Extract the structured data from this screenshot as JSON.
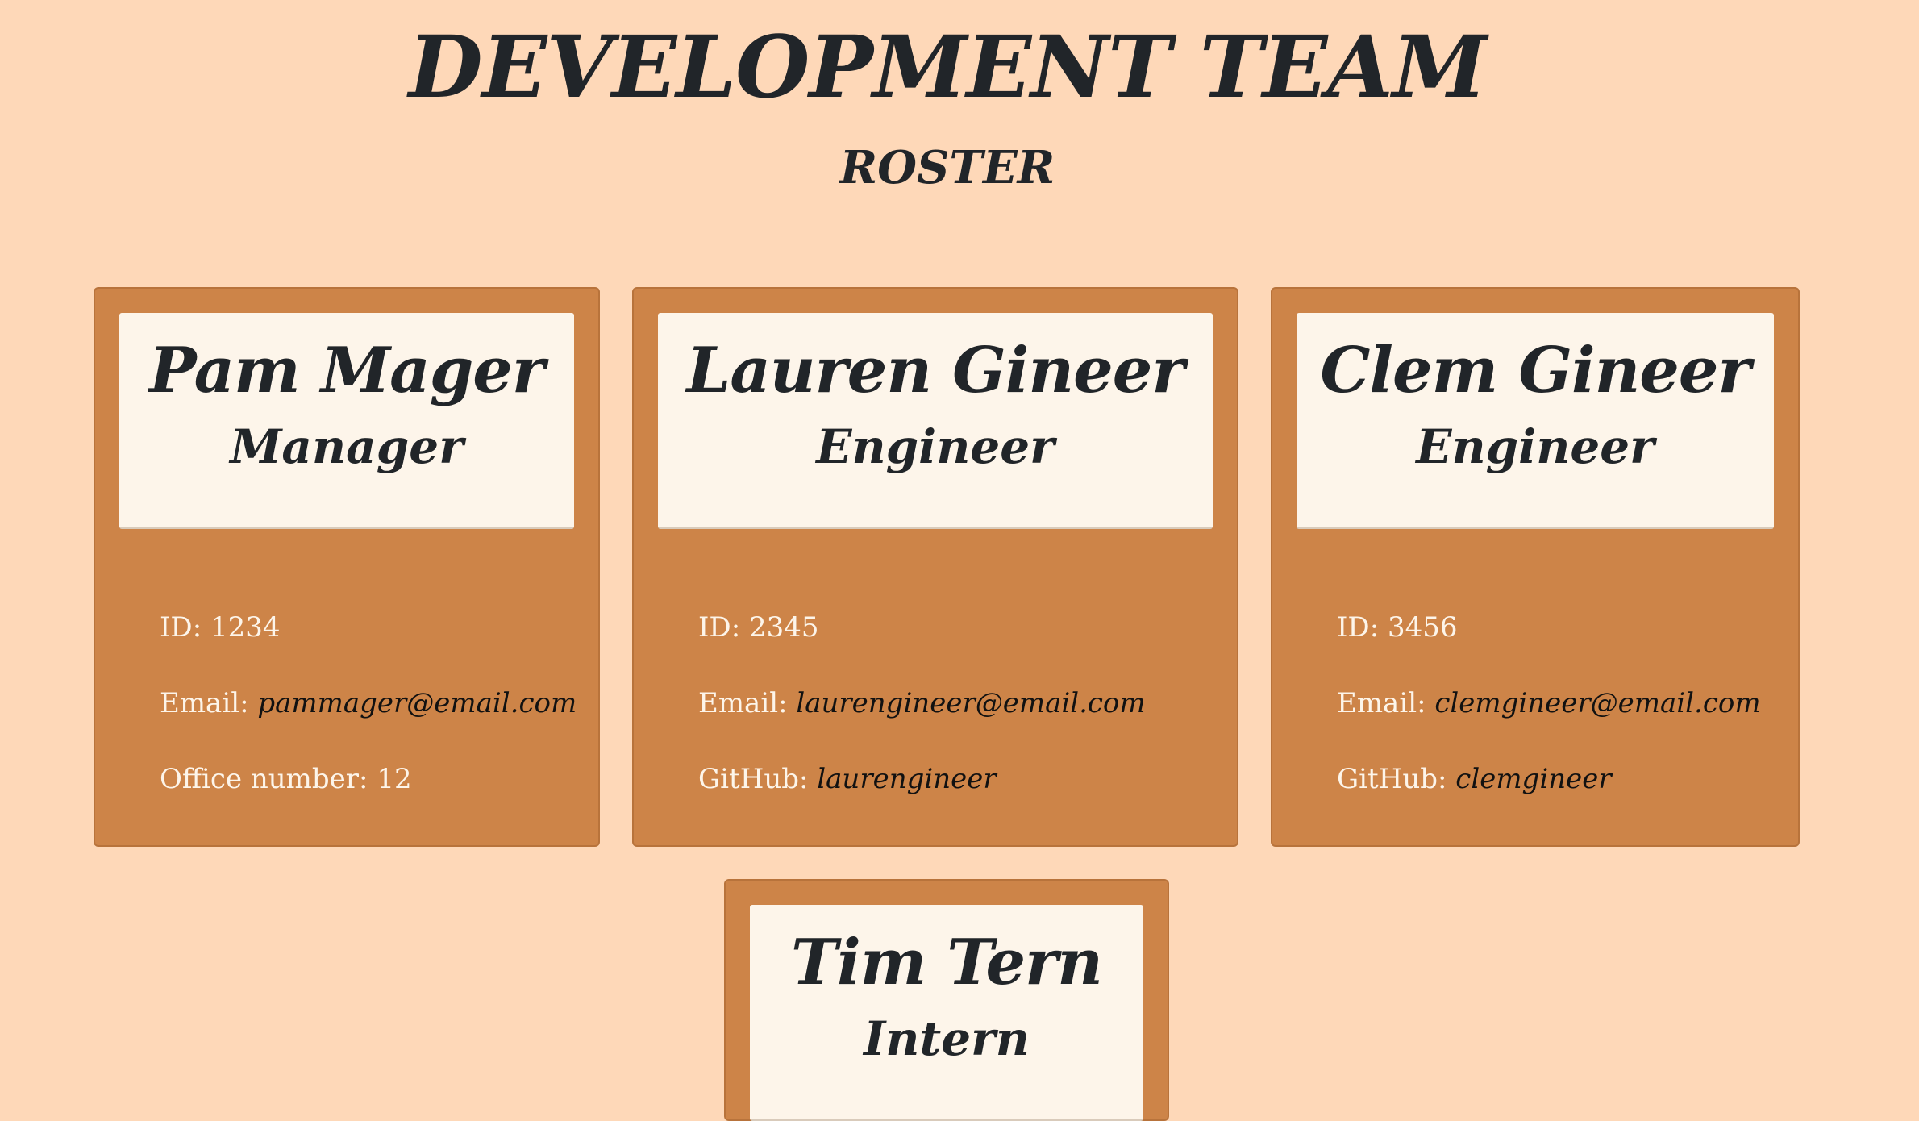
{
  "header": {
    "title": "DEVELOPMENT TEAM",
    "subtitle": "ROSTER"
  },
  "colors": {
    "background": "#fed8b8",
    "card": "#cd8448",
    "card_header": "#fdf5ea",
    "text_dark": "#212529",
    "text_light": "#fdf5ea"
  },
  "employees": [
    {
      "name": "Pam Mager",
      "role": "Manager",
      "id_label": "ID:",
      "id": "1234",
      "email_label": "Email:",
      "email": "pammager@email.com",
      "extra_label": "Office number:",
      "extra": "12"
    },
    {
      "name": "Lauren Gineer",
      "role": "Engineer",
      "id_label": "ID:",
      "id": "2345",
      "email_label": "Email:",
      "email": "laurengineer@email.com",
      "extra_label": "GitHub:",
      "extra": "laurengineer"
    },
    {
      "name": "Clem Gineer",
      "role": "Engineer",
      "id_label": "ID:",
      "id": "3456",
      "email_label": "Email:",
      "email": "clemgineer@email.com",
      "extra_label": "GitHub:",
      "extra": "clemgineer"
    },
    {
      "name": "Tim Tern",
      "role": "Intern"
    }
  ]
}
